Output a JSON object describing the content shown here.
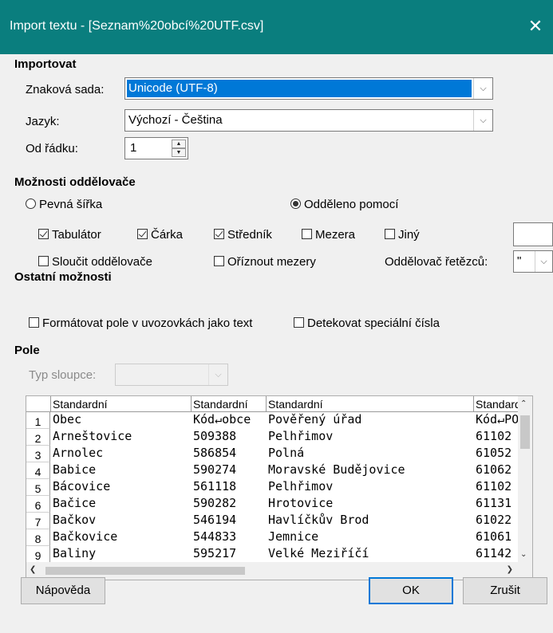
{
  "window": {
    "title": "Import textu - [Seznam%20obcí%20UTF.csv]",
    "close_glyph": "✕"
  },
  "import": {
    "section": "Importovat",
    "charset_label": "Znaková sada:",
    "charset_value": "Unicode (UTF-8)",
    "language_label": "Jazyk:",
    "language_value": "Výchozí - Čeština",
    "from_row_label": "Od řádku:",
    "from_row_value": "1"
  },
  "separator": {
    "section": "Možnosti oddělovače",
    "fixed_width": "Pevná šířka",
    "separated_by": "Odděleno pomocí",
    "mode": "separated",
    "tab": {
      "label": "Tabulátor",
      "checked": true
    },
    "comma": {
      "label": "Čárka",
      "checked": true
    },
    "semicolon": {
      "label": "Středník",
      "checked": true
    },
    "space": {
      "label": "Mezera",
      "checked": false
    },
    "other": {
      "label": "Jiný",
      "checked": false,
      "value": ""
    },
    "merge": {
      "label": "Sloučit oddělovače",
      "checked": false
    },
    "trim": {
      "label": "Oříznout mezery",
      "checked": false
    },
    "string_delim_label": "Oddělovač řetězců:",
    "string_delim_value": "\""
  },
  "other_options": {
    "section": "Ostatní možnosti",
    "quoted_as_text": {
      "label": "Formátovat pole v uvozovkách jako text",
      "checked": false
    },
    "detect_special": {
      "label": "Detekovat speciální čísla",
      "checked": false
    }
  },
  "fields": {
    "section": "Pole",
    "column_type_label": "Typ sloupce:",
    "column_type_value": ""
  },
  "preview": {
    "headers": [
      "Standardní",
      "Standardní",
      "Standardní",
      "Standardní"
    ],
    "rows": [
      {
        "n": "1",
        "cells": [
          "Obec",
          "Kód↵obce",
          "Pověřený úřad",
          "Kód↵POU"
        ]
      },
      {
        "n": "2",
        "cells": [
          "Arneštovice",
          "509388",
          "Pelhřimov",
          "61102"
        ]
      },
      {
        "n": "3",
        "cells": [
          "Arnolec",
          "586854",
          "Polná",
          "61052"
        ]
      },
      {
        "n": "4",
        "cells": [
          "Babice",
          "590274",
          "Moravské Budějovice",
          "61062"
        ]
      },
      {
        "n": "5",
        "cells": [
          "Bácovice",
          "561118",
          "Pelhřimov",
          "61102"
        ]
      },
      {
        "n": "6",
        "cells": [
          "Bačice",
          "590282",
          "Hrotovice",
          "61131"
        ]
      },
      {
        "n": "7",
        "cells": [
          "Bačkov",
          "546194",
          "Havlíčkův Brod",
          "61022"
        ]
      },
      {
        "n": "8",
        "cells": [
          "Bačkovice",
          "544833",
          "Jemnice",
          "61061"
        ]
      },
      {
        "n": "9",
        "cells": [
          "Baliny",
          "595217",
          "Velké Meziříčí",
          "61142"
        ]
      }
    ]
  },
  "buttons": {
    "help": "Nápověda",
    "ok": "OK",
    "cancel": "Zrušit"
  },
  "colors": {
    "titlebar": "#0a7e7e",
    "selection": "#0078d7"
  }
}
